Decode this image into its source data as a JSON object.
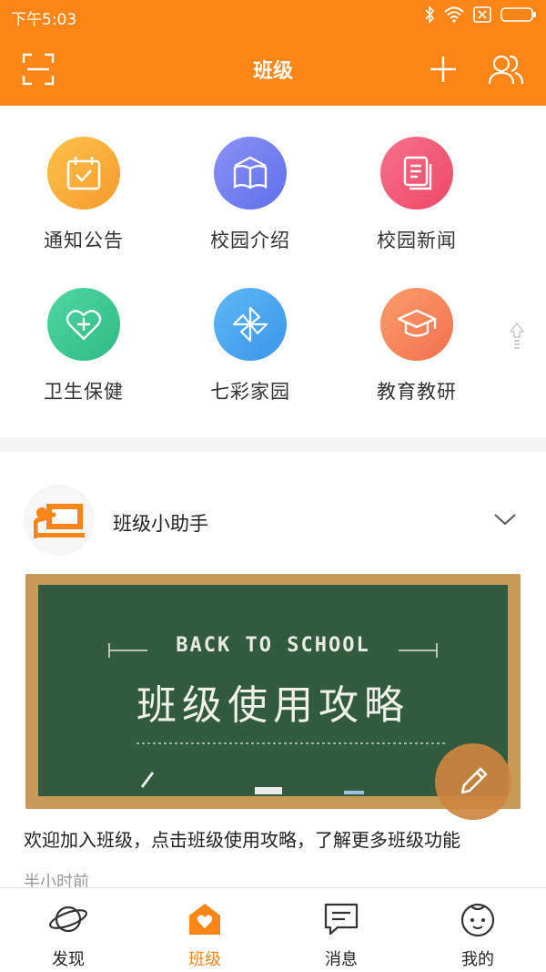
{
  "status_bar": {
    "time": "下午5:03"
  },
  "header": {
    "title": "班级"
  },
  "grid": {
    "items": [
      {
        "label": "通知公告",
        "icon": "calendar-check-icon",
        "color": "#f9a93a"
      },
      {
        "label": "校园介绍",
        "icon": "book-icon",
        "color": "#6f7ff2"
      },
      {
        "label": "校园新闻",
        "icon": "news-icon",
        "color": "#f05a78"
      },
      {
        "label": "卫生保健",
        "icon": "heart-plus-icon",
        "color": "#3ec995"
      },
      {
        "label": "七彩家园",
        "icon": "pinwheel-icon",
        "color": "#4aa8f0"
      },
      {
        "label": "教育教研",
        "icon": "graduation-cap-icon",
        "color": "#f68a5e"
      }
    ]
  },
  "feed": {
    "name": "班级小助手",
    "banner_top_text": "BACK TO SCHOOL",
    "banner_main_text": "班级使用攻略",
    "description": "欢迎加入班级，点击班级使用攻略，了解更多班级功能",
    "time": "半小时前"
  },
  "bottom_nav": {
    "items": [
      {
        "label": "发现",
        "icon": "planet-icon"
      },
      {
        "label": "班级",
        "icon": "house-heart-icon",
        "active": true
      },
      {
        "label": "消息",
        "icon": "message-icon"
      },
      {
        "label": "我的",
        "icon": "baby-face-icon"
      }
    ]
  },
  "colors": {
    "accent": "#fb8617"
  }
}
